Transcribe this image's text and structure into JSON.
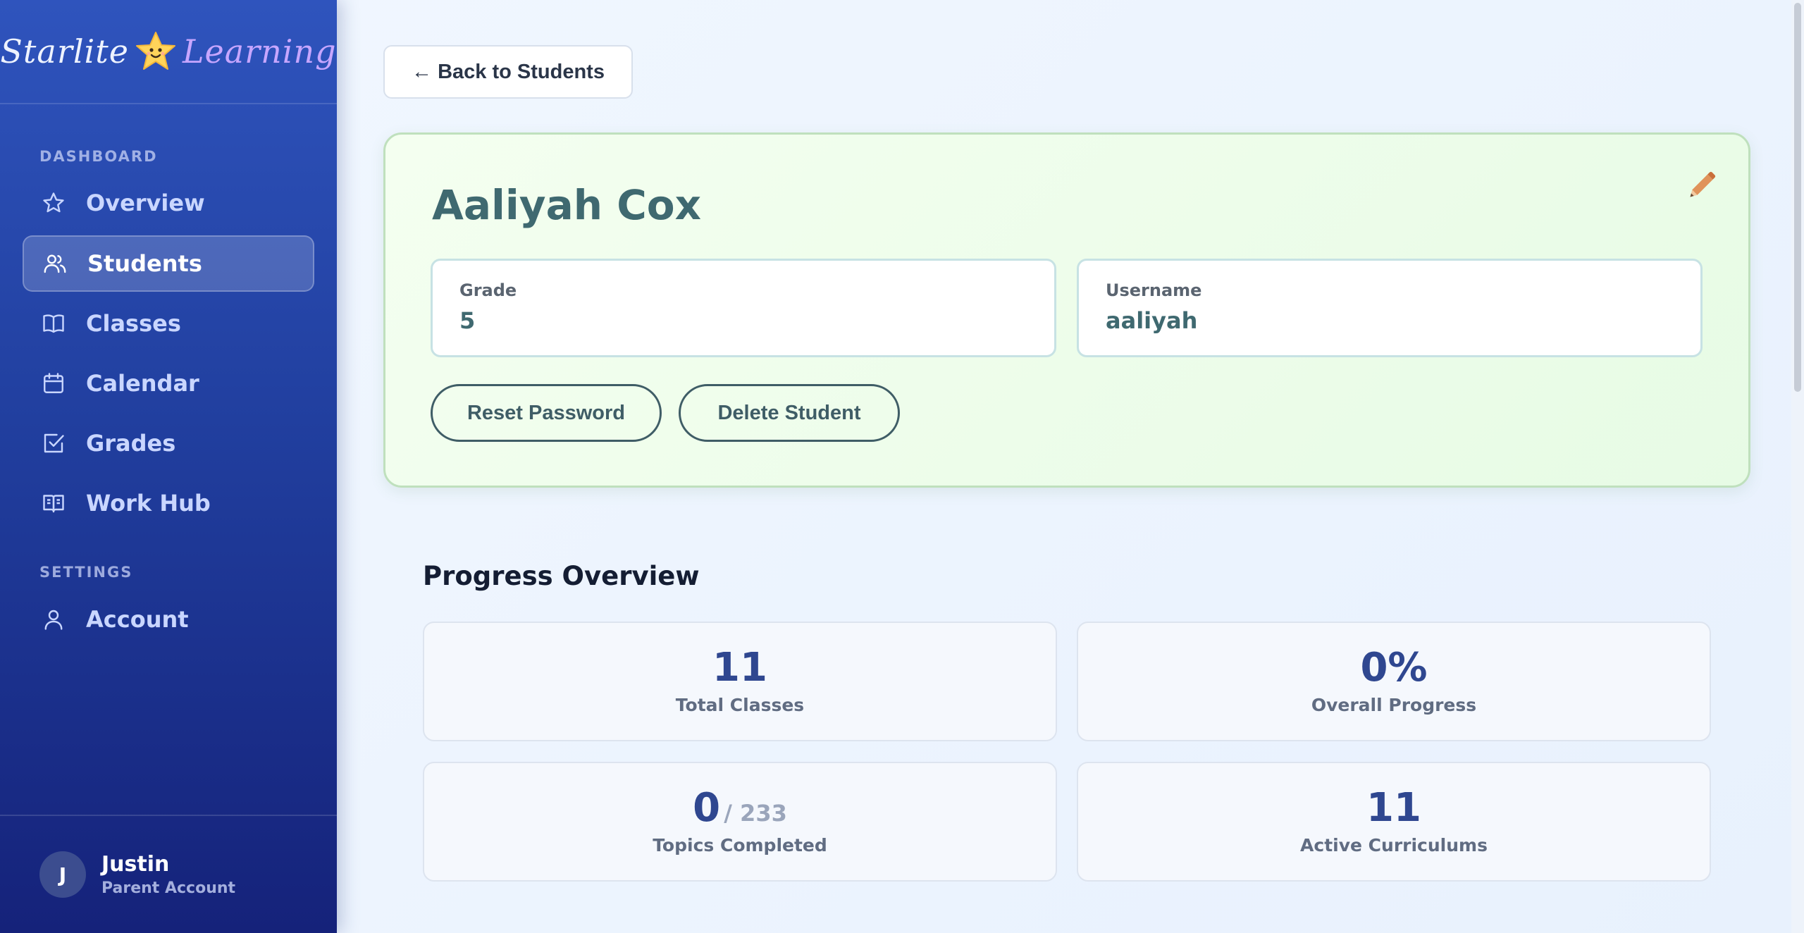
{
  "brand": {
    "word1": "Starlite",
    "word2": "Learning"
  },
  "sidebar": {
    "sections": [
      {
        "label": "DASHBOARD"
      },
      {
        "label": "SETTINGS"
      }
    ],
    "items": [
      {
        "label": "Overview",
        "icon": "star-icon"
      },
      {
        "label": "Students",
        "icon": "users-icon",
        "active": true
      },
      {
        "label": "Classes",
        "icon": "book-icon"
      },
      {
        "label": "Calendar",
        "icon": "calendar-icon"
      },
      {
        "label": "Grades",
        "icon": "checkbox-icon"
      },
      {
        "label": "Work Hub",
        "icon": "open-book-icon"
      },
      {
        "label": "Account",
        "icon": "user-icon"
      }
    ],
    "user": {
      "initial": "J",
      "name": "Justin",
      "role": "Parent Account"
    }
  },
  "main": {
    "back_label": "← Back to Students",
    "student": {
      "name": "Aaliyah Cox",
      "grade_label": "Grade",
      "grade_value": "5",
      "username_label": "Username",
      "username_value": "aaliyah",
      "reset_label": "Reset Password",
      "delete_label": "Delete Student"
    },
    "progress": {
      "title": "Progress Overview",
      "stats": [
        {
          "value": "11",
          "label": "Total Classes"
        },
        {
          "value": "0%",
          "label": "Overall Progress"
        },
        {
          "value": "0",
          "sub": "/ 233",
          "label": "Topics Completed"
        },
        {
          "value": "11",
          "label": "Active Curriculums"
        }
      ]
    }
  },
  "colors": {
    "sidebar_top": "#2f54bd",
    "sidebar_bottom": "#15227a",
    "accent_teal": "#3f6970",
    "card_green": "#e7fbe5",
    "stat_value": "#2f4790",
    "edit_orange": "#e08a4a"
  }
}
